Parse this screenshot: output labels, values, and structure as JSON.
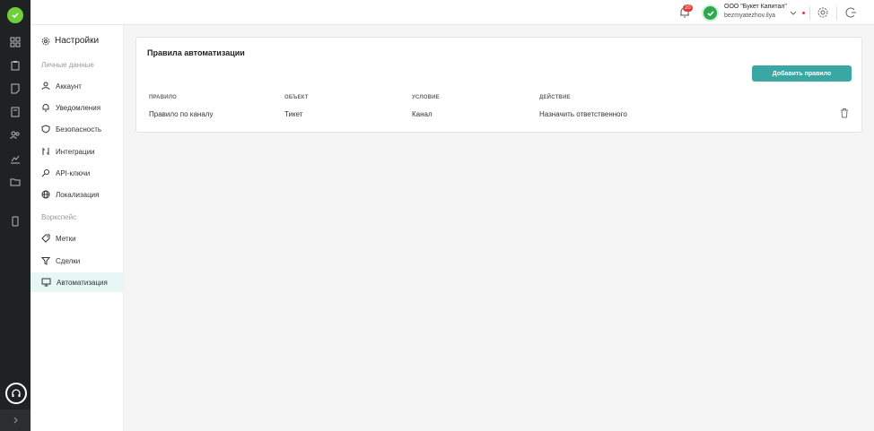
{
  "topbar": {
    "notifications_count": "20",
    "org_name": "ООО \"Букет Капитал\"",
    "user_name": "bezmyatezhov.ilya"
  },
  "sidebar": {
    "title": "Настройки",
    "section_personal": "Личные данные",
    "section_workspace": "Воркспейс",
    "items": [
      {
        "label": "Аккаунт",
        "icon": "user-icon"
      },
      {
        "label": "Уведомления",
        "icon": "bell-icon"
      },
      {
        "label": "Безопасность",
        "icon": "shield-icon"
      },
      {
        "label": "Интеграции",
        "icon": "integration-icon"
      },
      {
        "label": "API-ключи",
        "icon": "key-icon"
      },
      {
        "label": "Локализация",
        "icon": "globe-icon"
      },
      {
        "label": "Метки",
        "icon": "tag-icon"
      },
      {
        "label": "Сделки",
        "icon": "filter-icon"
      },
      {
        "label": "Автоматизация",
        "icon": "monitor-icon",
        "active": true
      }
    ]
  },
  "main": {
    "title": "Правила автоматизации",
    "add_button": "Добавить правило",
    "columns": [
      "ПРАВИЛО",
      "ОБЪЕКТ",
      "УСЛОВИЕ",
      "ДЕЙСТВИЕ"
    ],
    "rows": [
      [
        "Правило по каналу",
        "Тикет",
        "Канал",
        "Назначить ответственного"
      ]
    ]
  },
  "colors": {
    "accent": "#3aa7a3",
    "rail": "#1f2223",
    "active_bg": "#e6f7f6",
    "badge": "#e53935"
  }
}
